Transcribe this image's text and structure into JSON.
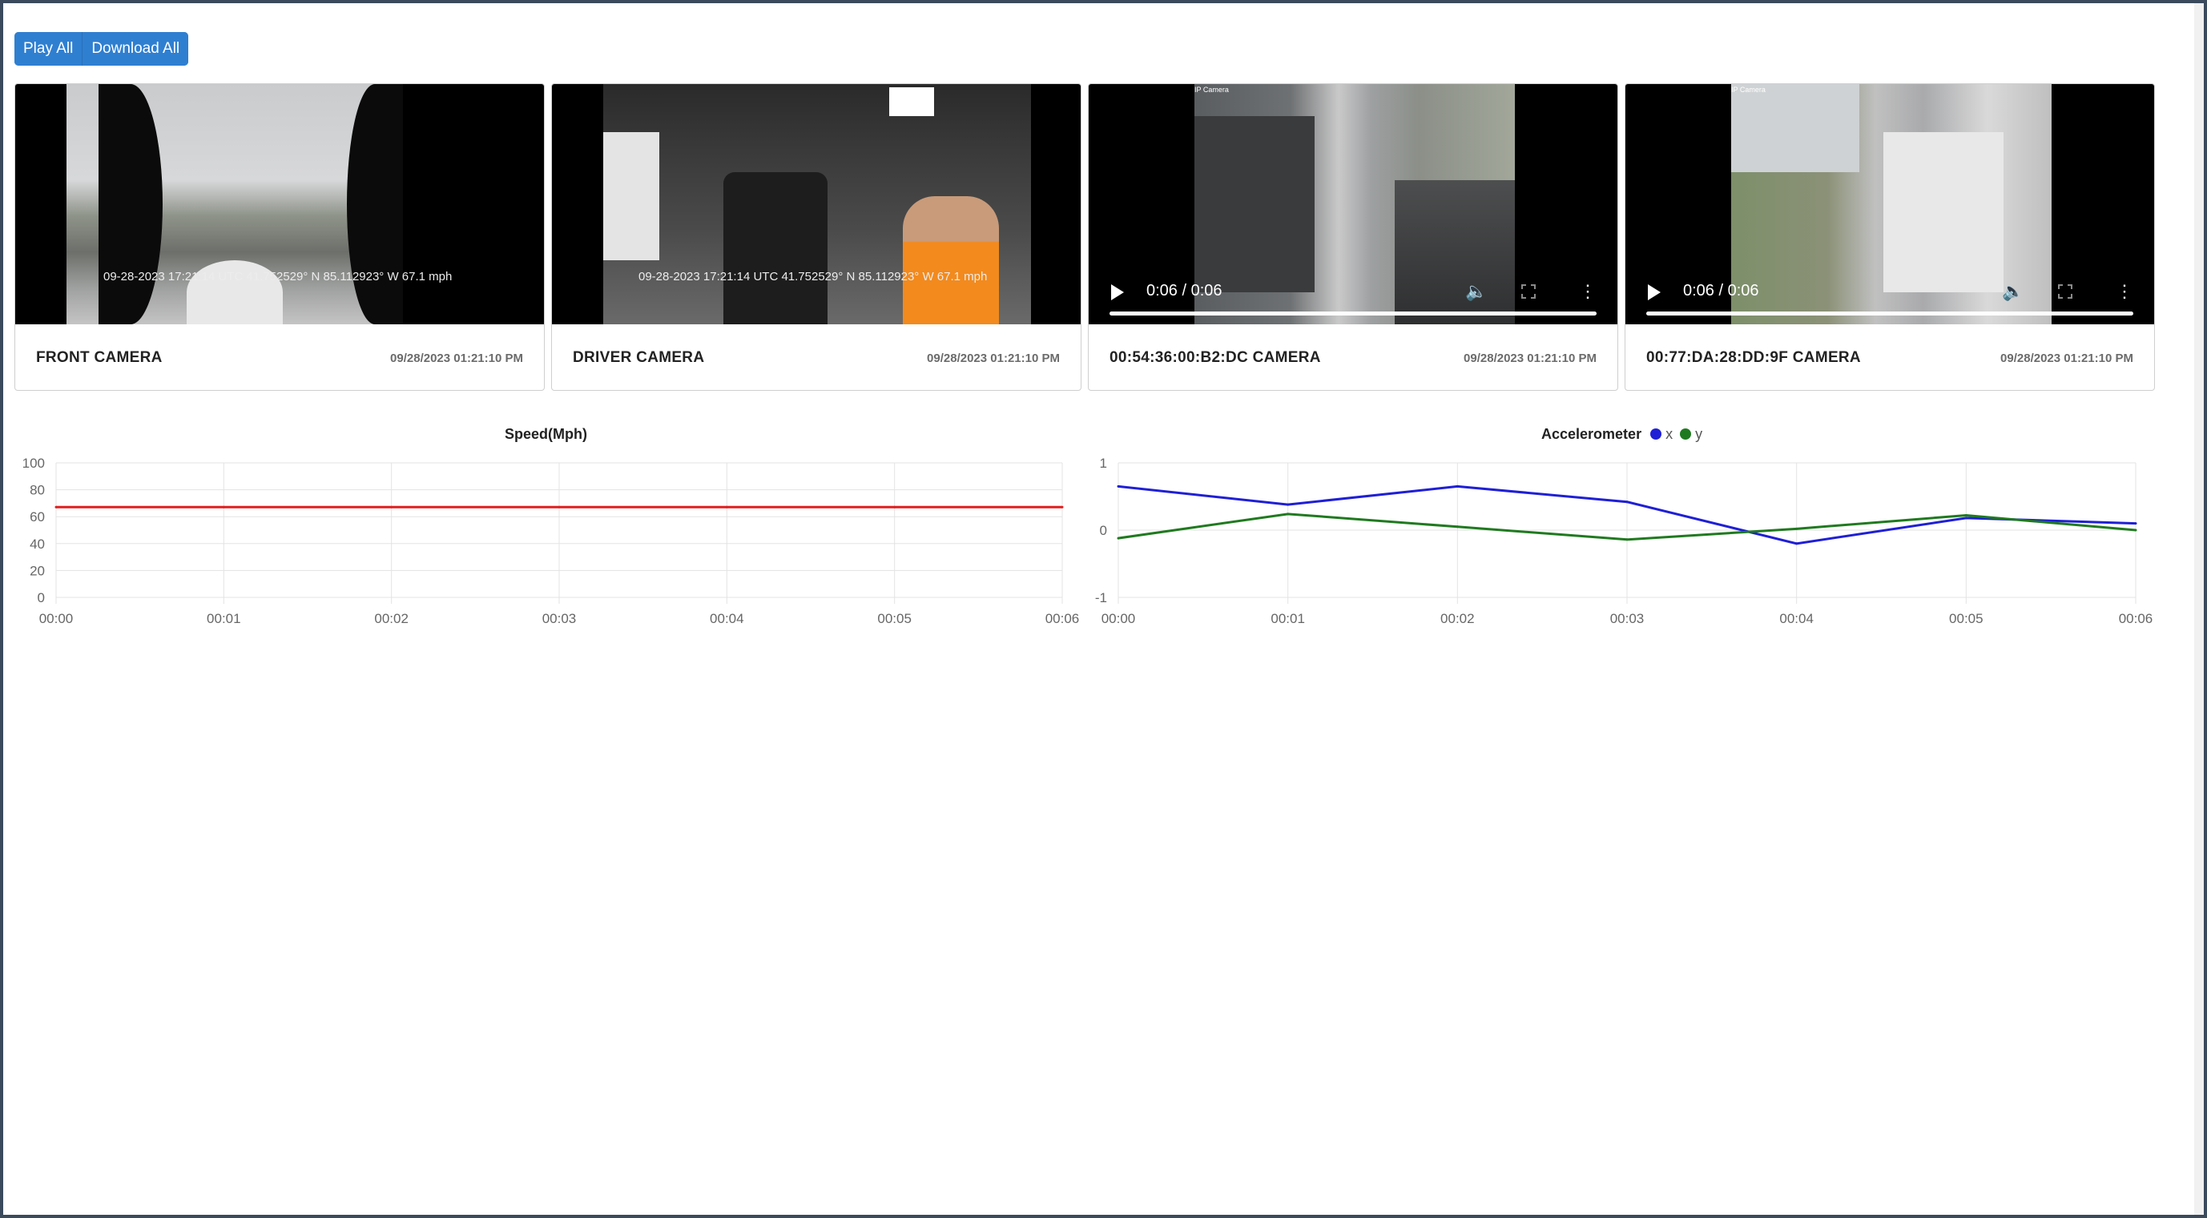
{
  "toolbar": {
    "play_all": "Play All",
    "download_all": "Download All"
  },
  "cameras": [
    {
      "title": "FRONT CAMERA",
      "timestamp": "09/28/2023 01:21:10 PM",
      "overlay": "09-28-2023 17:21:14 UTC 41.752529° N 85.112923° W  67.1 mph",
      "type": "image"
    },
    {
      "title": "DRIVER CAMERA",
      "timestamp": "09/28/2023 01:21:10 PM",
      "overlay": "09-28-2023 17:21:14 UTC 41.752529° N 85.112923° W  67.1 mph",
      "type": "image"
    },
    {
      "title": "00:54:36:00:B2:DC CAMERA",
      "timestamp": "09/28/2023 01:21:10 PM",
      "video_time": "0:06 / 0:06",
      "ip_label": "IP Camera",
      "type": "video",
      "progress": 1.0
    },
    {
      "title": "00:77:DA:28:DD:9F CAMERA",
      "timestamp": "09/28/2023 01:21:10 PM",
      "video_time": "0:06 / 0:06",
      "ip_label": "IP Camera",
      "type": "video",
      "progress": 1.0
    }
  ],
  "chart_data": [
    {
      "type": "line",
      "title": "Speed(Mph)",
      "x": [
        "00:00",
        "00:01",
        "00:02",
        "00:03",
        "00:04",
        "00:05",
        "00:06"
      ],
      "series": [
        {
          "values": [
            67.1,
            67.1,
            67.1,
            67.1,
            67.1,
            67.1,
            67.1
          ],
          "color": "#e01f1f"
        }
      ],
      "ylim": [
        0,
        100
      ],
      "yticks": [
        0,
        20,
        40,
        60,
        80,
        100
      ],
      "grid": true
    },
    {
      "type": "line",
      "title": "Accelerometer",
      "x": [
        "00:00",
        "00:01",
        "00:02",
        "00:03",
        "00:04",
        "00:05",
        "00:06"
      ],
      "series": [
        {
          "name": "x",
          "values": [
            0.65,
            0.38,
            0.65,
            0.42,
            -0.2,
            0.18,
            0.1
          ],
          "color": "#1f1fd6"
        },
        {
          "name": "y",
          "values": [
            -0.12,
            0.24,
            0.05,
            -0.14,
            0.02,
            0.22,
            0.0
          ],
          "color": "#1f7a1f"
        }
      ],
      "ylim": [
        -1,
        1
      ],
      "yticks": [
        -1,
        0,
        1
      ],
      "grid": true,
      "legend": "top"
    }
  ]
}
